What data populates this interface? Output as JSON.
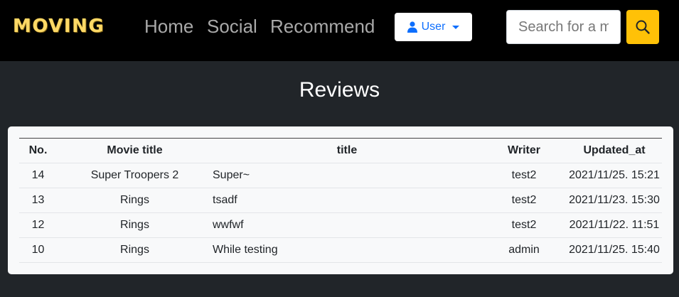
{
  "navbar": {
    "brand": "MOVING",
    "links": [
      "Home",
      "Social",
      "Recommend"
    ],
    "user_label": "User",
    "search_placeholder": "Search for a movie"
  },
  "page": {
    "heading": "Reviews"
  },
  "reviews_table": {
    "headers": [
      "No.",
      "Movie title",
      "title",
      "Writer",
      "Updated_at"
    ],
    "rows": [
      [
        "14",
        "Super Troopers 2",
        "Super~",
        "test2",
        "2021/11/25. 15:21"
      ],
      [
        "13",
        "Rings",
        "tsadf",
        "test2",
        "2021/11/23. 15:30"
      ],
      [
        "12",
        "Rings",
        "wwfwf",
        "test2",
        "2021/11/22. 11:51"
      ],
      [
        "10",
        "Rings",
        "While testing",
        "admin",
        "2021/11/25. 15:40"
      ]
    ]
  },
  "colors": {
    "navbar_bg": "#000000",
    "page_bg": "#212529",
    "brand": "#ffd966",
    "accent_yellow": "#ffc107",
    "link_gray": "#a9a9a9",
    "user_blue": "#0d6efd",
    "card_bg": "#f8f9fa"
  },
  "icons": {
    "user_button": "person-icon",
    "dropdown": "caret-down-icon",
    "search_button": "magnifier-icon"
  }
}
